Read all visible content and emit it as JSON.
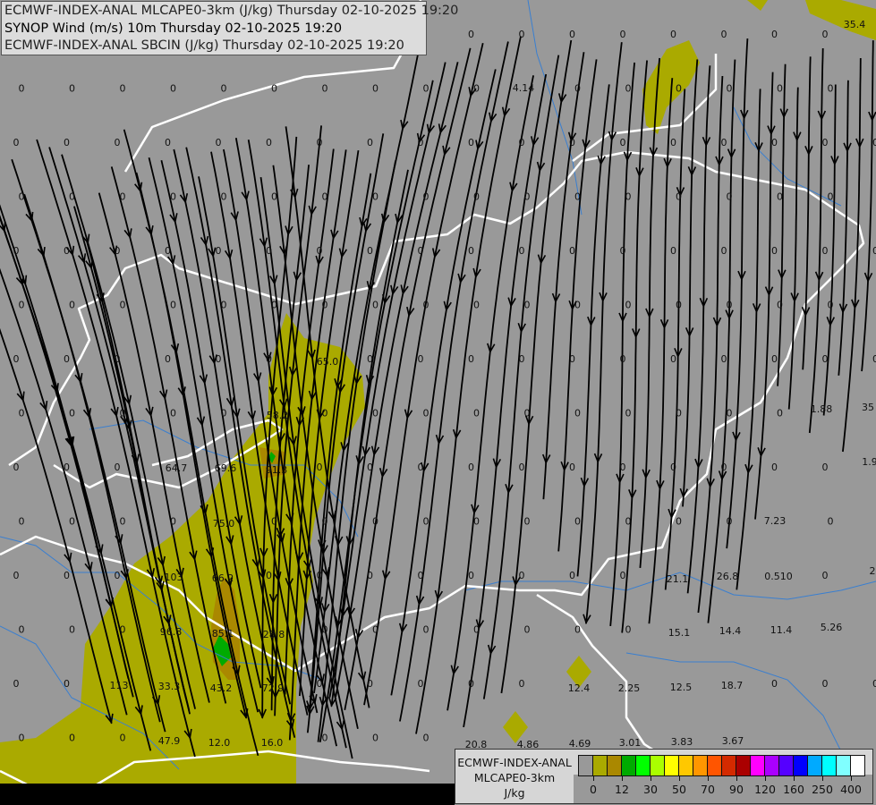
{
  "header": {
    "lines": [
      "ECMWF-INDEX-ANAL MLCAPE0-3km (J/kg) Thursday 02-10-2025 19:20",
      "SYNOP Wind (m/s) 10m Thursday 02-10-2025 19:20",
      "ECMWF-INDEX-ANAL SBCIN (J/kg) Thursday 02-10-2025 19:20"
    ]
  },
  "map": {
    "background_color": "#999999",
    "cape_fill_color": "#aaaa00",
    "cape_fill_color_2": "#aa8800",
    "cape_fill_color_3": "#00aa00",
    "border_color": "#ffffff",
    "river_color": "#3a7fd0",
    "streamline_color": "#000000",
    "zero_value": "0",
    "station_values": [
      "35.4",
      "4.14",
      "65.0",
      "58.2",
      "64.7",
      "69.6",
      "91.3",
      "75.0",
      "103",
      "66.2",
      "96.8",
      "85.1",
      "28.8",
      "113",
      "33.3",
      "43.2",
      "72.9",
      "47.9",
      "12.0",
      "16.0",
      "1.88",
      "35",
      "1.9",
      "7.23",
      "21.1",
      "26.8",
      "0.510",
      "2",
      "15.1",
      "14.4",
      "11.4",
      "5.26",
      "12.4",
      "2.25",
      "12.5",
      "18.7",
      "20.8",
      "4.86",
      "4.69",
      "3.01",
      "3.83",
      "3.67"
    ]
  },
  "legend": {
    "title": "ECMWF-INDEX-ANAL",
    "parameter": "MLCAPE0-3km",
    "unit": "J/kg",
    "colors": [
      "#999999",
      "#aaaa00",
      "#aa8800",
      "#00aa00",
      "#00ff00",
      "#aaff00",
      "#ffff00",
      "#ffc800",
      "#ff9600",
      "#ff5500",
      "#d42a00",
      "#aa0000",
      "#ff00ff",
      "#aa00ff",
      "#5500ff",
      "#0000ff",
      "#00aaff",
      "#00ffff",
      "#80ffff",
      "#ffffff"
    ],
    "tick_labels": [
      "0",
      "12",
      "30",
      "50",
      "70",
      "90",
      "120",
      "160",
      "250",
      "400"
    ]
  }
}
